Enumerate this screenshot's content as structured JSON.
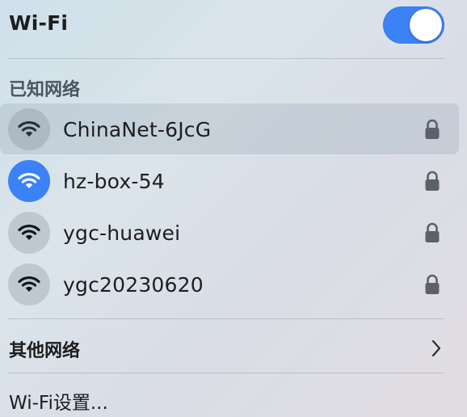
{
  "header": {
    "title": "Wi-Fi",
    "toggle_on": true
  },
  "known_networks": {
    "label": "已知网络",
    "items": [
      {
        "name": "ChinaNet-6JcG",
        "secured": true,
        "connected": false,
        "highlighted": true
      },
      {
        "name": "hz-box-54",
        "secured": true,
        "connected": true,
        "highlighted": false
      },
      {
        "name": "ygc-huawei",
        "secured": true,
        "connected": false,
        "highlighted": false
      },
      {
        "name": "ygc20230620",
        "secured": true,
        "connected": false,
        "highlighted": false
      }
    ]
  },
  "other_networks": {
    "label": "其他网络"
  },
  "settings": {
    "label": "Wi-Fi设置..."
  },
  "icons": {
    "wifi": "wifi-icon",
    "lock": "lock-icon",
    "chevron": "chevron-right-icon"
  },
  "colors": {
    "accent": "#3b82f6"
  }
}
